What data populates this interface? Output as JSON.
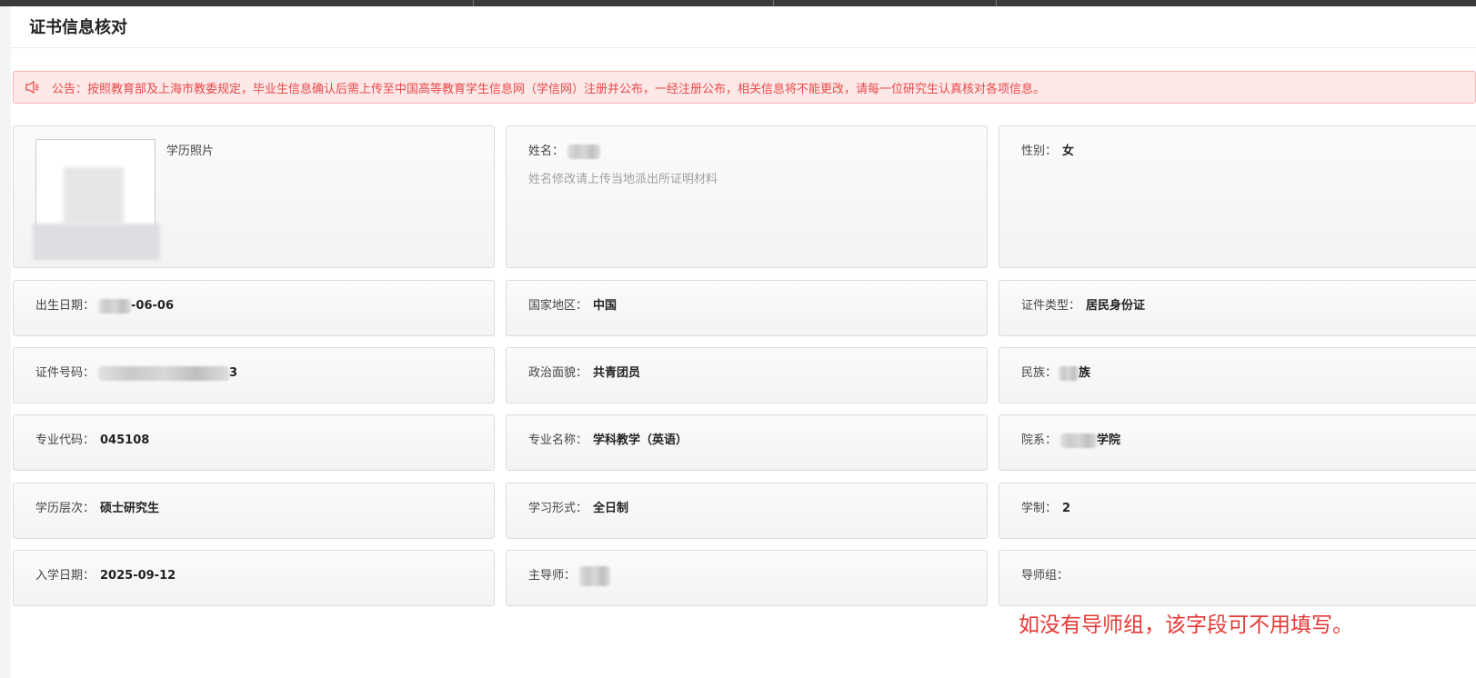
{
  "page": {
    "title": "证书信息核对"
  },
  "notice": {
    "icon": "speaker-icon",
    "text": "公告：按照教育部及上海市教委规定，毕业生信息确认后需上传至中国高等教育学生信息网（学信网）注册并公布，一经注册公布，相关信息将不能更改，请每一位研究生认真核对各项信息。"
  },
  "photo": {
    "label": "学历照片"
  },
  "name": {
    "label": "姓名：",
    "value_suffix": "",
    "hint": "姓名修改请上传当地派出所证明材料"
  },
  "gender": {
    "label": "性别：",
    "value": "女"
  },
  "birth": {
    "label": "出生日期：",
    "value_suffix": "-06-06"
  },
  "country": {
    "label": "国家地区：",
    "value": "中国"
  },
  "id_type": {
    "label": "证件类型：",
    "value": "居民身份证"
  },
  "id_number": {
    "label": "证件号码：",
    "value_suffix": "3"
  },
  "political": {
    "label": "政治面貌：",
    "value": "共青团员"
  },
  "ethnicity": {
    "label": "民族：",
    "value_suffix": "族"
  },
  "major_code": {
    "label": "专业代码：",
    "value": "045108"
  },
  "major_name": {
    "label": "专业名称：",
    "value": "学科教学（英语）"
  },
  "department": {
    "label": "院系：",
    "value_suffix": "学院"
  },
  "degree_level": {
    "label": "学历层次：",
    "value": "硕士研究生"
  },
  "study_form": {
    "label": "学习形式：",
    "value": "全日制"
  },
  "duration": {
    "label": "学制：",
    "value": "2"
  },
  "enroll_date": {
    "label": "入学日期：",
    "value": "2025-09-12"
  },
  "advisor": {
    "label": "主导师："
  },
  "advisor_group": {
    "label": "导师组："
  },
  "annotation": {
    "text": "如没有导师组，该字段可不用填写。"
  },
  "colors": {
    "notice_bg": "#fde8e8",
    "notice_text": "#e84a4a",
    "annotation": "#e53935"
  }
}
